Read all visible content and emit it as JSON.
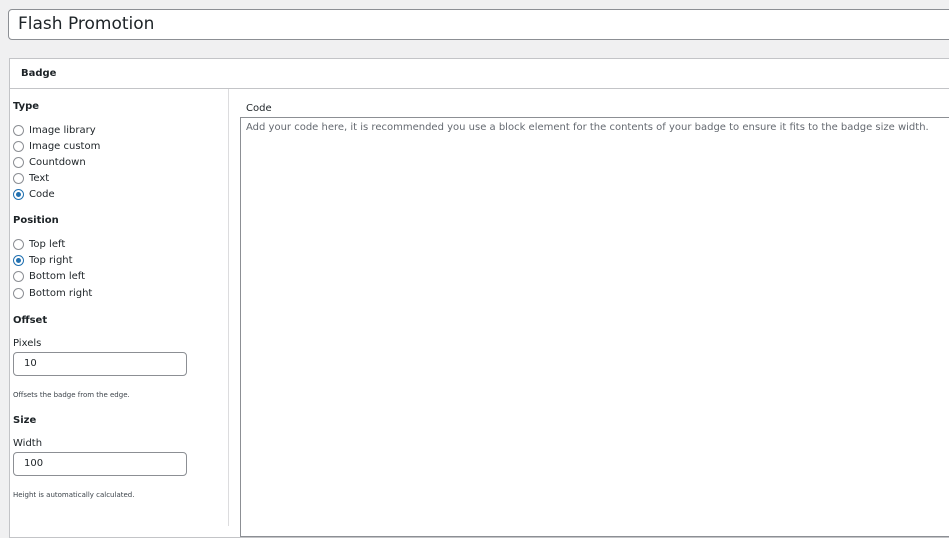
{
  "post_title": "Flash Promotion",
  "badge_box": {
    "title": "Badge",
    "type": {
      "heading": "Type",
      "options": [
        "Image library",
        "Image custom",
        "Countdown",
        "Text",
        "Code"
      ],
      "selected": "Code"
    },
    "position": {
      "heading": "Position",
      "options": [
        "Top left",
        "Top right",
        "Bottom left",
        "Bottom right"
      ],
      "selected": "Top right"
    },
    "offset": {
      "heading": "Offset",
      "pixels_label": "Pixels",
      "pixels_value": "10",
      "help": "Offsets the badge from the edge."
    },
    "size": {
      "heading": "Size",
      "width_label": "Width",
      "width_value": "100",
      "help": "Height is automatically calculated."
    },
    "code": {
      "label": "Code",
      "placeholder": "Add your code here, it is recommended you use a block element for the contents of your badge to ensure it fits to the badge size width."
    }
  },
  "colors": {
    "accent": "#2271b1",
    "border": "#8c8f94",
    "background": "#f0f0f1"
  }
}
